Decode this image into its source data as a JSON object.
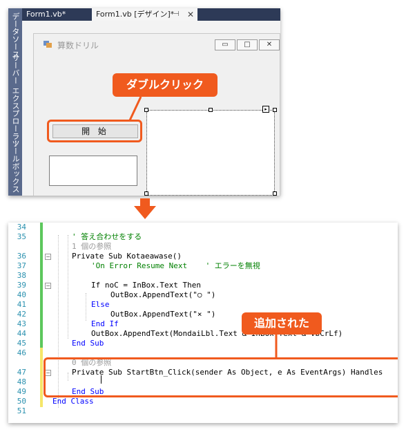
{
  "designer": {
    "side_tabs": [
      "データソース",
      "サーバー エクスプローラー",
      "ツールボックス"
    ],
    "tabs": [
      {
        "label": "Form1.vb*",
        "active": false
      },
      {
        "label": "Form1.vb [デザイン]*",
        "active": true
      }
    ],
    "form_title": "算数ドリル",
    "window_buttons": [
      "▭",
      "□",
      "✕"
    ],
    "start_button_label": "開 始",
    "callout": "ダブルクリック"
  },
  "code_editor": {
    "callout": "追加された",
    "lines": [
      {
        "n": "34",
        "text": ""
      },
      {
        "n": "35",
        "text": "' 答え合わせをする"
      },
      {
        "n": "",
        "text": "1 個の参照"
      },
      {
        "n": "36",
        "text": "Private Sub Kotaeawase()"
      },
      {
        "n": "37",
        "text": "'On Error Resume Next    ' エラーを無視"
      },
      {
        "n": "38",
        "text": ""
      },
      {
        "n": "39",
        "text": "If noC = InBox.Text Then"
      },
      {
        "n": "40",
        "text": "OutBox.AppendText(\"○ \")"
      },
      {
        "n": "41",
        "text": "Else"
      },
      {
        "n": "42",
        "text": "OutBox.AppendText(\"× \")"
      },
      {
        "n": "43",
        "text": "End If"
      },
      {
        "n": "44",
        "text": "OutBox.AppendText(MondaiLbl.Text & InBox.Text & vbCrLf)"
      },
      {
        "n": "45",
        "text": "End Sub"
      },
      {
        "n": "46",
        "text": ""
      },
      {
        "n": "",
        "text": "0 個の参照"
      },
      {
        "n": "47",
        "text": "Private Sub StartBtn_Click(sender As Object, e As EventArgs) Handles"
      },
      {
        "n": "48",
        "text": ""
      },
      {
        "n": "49",
        "text": "End Sub"
      },
      {
        "n": "50",
        "text": "End Class"
      },
      {
        "n": "51",
        "text": ""
      }
    ]
  },
  "colors": {
    "accent": "#f05a1e",
    "keyword": "#0000ff",
    "comment": "#008000",
    "line_number": "#2b91af",
    "change_saved": "#5cc75c",
    "change_unsaved": "#f5e66a"
  }
}
